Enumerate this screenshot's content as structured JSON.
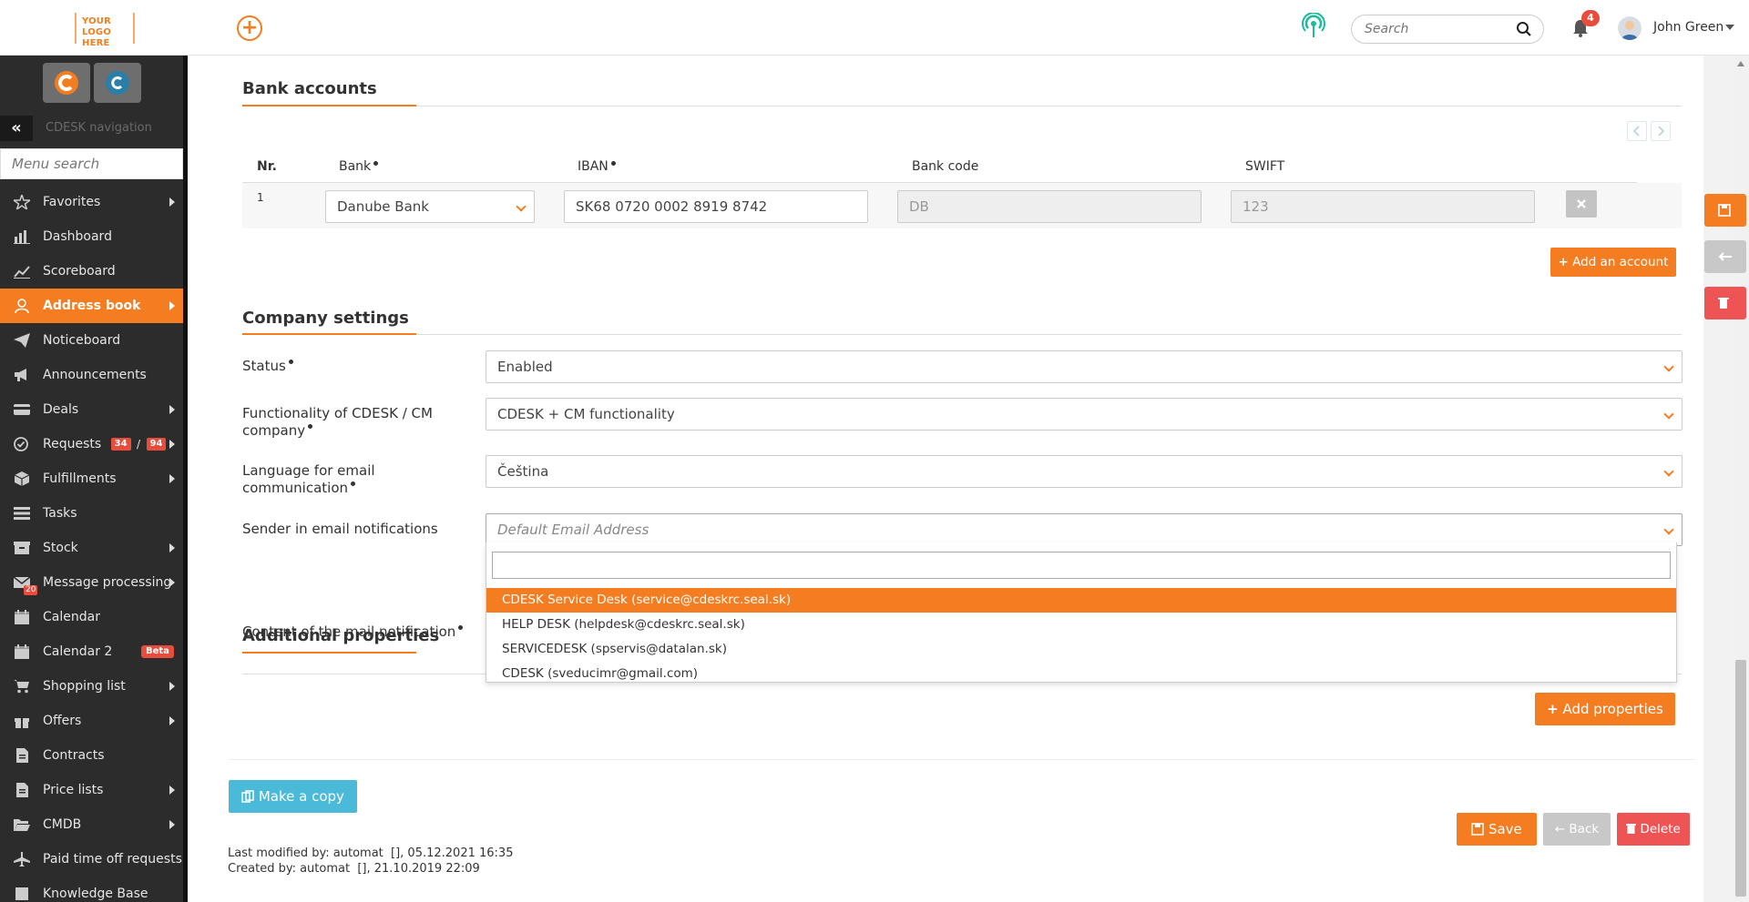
{
  "topbar": {
    "logo_line1": "YOUR LOGO",
    "logo_line2": "HERE",
    "search_placeholder": "Search",
    "notifications_count": "4",
    "user_name": "John Green"
  },
  "sidebar": {
    "nav_title": "CDESK navigation",
    "menu_search_placeholder": "Menu search",
    "items": [
      {
        "label": "Favorites"
      },
      {
        "label": "Dashboard"
      },
      {
        "label": "Scoreboard"
      },
      {
        "label": "Address book"
      },
      {
        "label": "Noticeboard"
      },
      {
        "label": "Announcements"
      },
      {
        "label": "Deals"
      },
      {
        "label": "Requests",
        "badge1": "34",
        "sep": "/",
        "badge2": "94"
      },
      {
        "label": "Fulfillments"
      },
      {
        "label": "Tasks"
      },
      {
        "label": "Stock"
      },
      {
        "label": "Message processing",
        "badge": "20"
      },
      {
        "label": "Calendar"
      },
      {
        "label": "Calendar 2",
        "badge": "Beta"
      },
      {
        "label": "Shopping list"
      },
      {
        "label": "Offers"
      },
      {
        "label": "Contracts"
      },
      {
        "label": "Price lists"
      },
      {
        "label": "CMDB"
      },
      {
        "label": "Paid time off requests"
      },
      {
        "label": "Knowledge Base"
      }
    ]
  },
  "bank_accounts": {
    "title": "Bank accounts",
    "headers": {
      "nr": "Nr.",
      "bank": "Bank",
      "iban": "IBAN",
      "bank_code": "Bank code",
      "swift": "SWIFT"
    },
    "rows": [
      {
        "nr": "1",
        "bank": "Danube Bank",
        "iban": "SK68 0720 0002 8919 8742",
        "bank_code": "DB",
        "swift": "123"
      }
    ],
    "add_button": "Add an account"
  },
  "company_settings": {
    "title": "Company settings",
    "status_label": "Status",
    "status_value": "Enabled",
    "functionality_label": "Functionality of CDESK / CM company",
    "functionality_value": "CDESK + CM functionality",
    "language_label": "Language for email communication",
    "language_value": "Čeština",
    "sender_label": "Sender in email notifications",
    "sender_placeholder": "Default Email Address",
    "content_label": "Content of the mail notification",
    "sender_options": [
      "CDESK Service Desk (service@cdeskrc.seal.sk)",
      "HELP DESK (helpdesk@cdeskrc.seal.sk)",
      "SERVICEDESK (spservis@datalan.sk)",
      "CDESK (sveducimr@gmail.com)"
    ]
  },
  "additional_properties": {
    "title": "Additional properties",
    "add_button": "Add properties"
  },
  "footer": {
    "copy_button": "Make a copy",
    "save_button": "Save",
    "back_button": "Back",
    "delete_button": "Delete",
    "last_modified": "Last modified by: automat  [], 05.12.2021 16:35",
    "created": "Created by: automat  [], 21.10.2019 22:09"
  },
  "colors": {
    "accent": "#f47c21",
    "sidebar": "#2c2c2c",
    "danger": "#ee5454",
    "info": "#4bb9d8"
  }
}
